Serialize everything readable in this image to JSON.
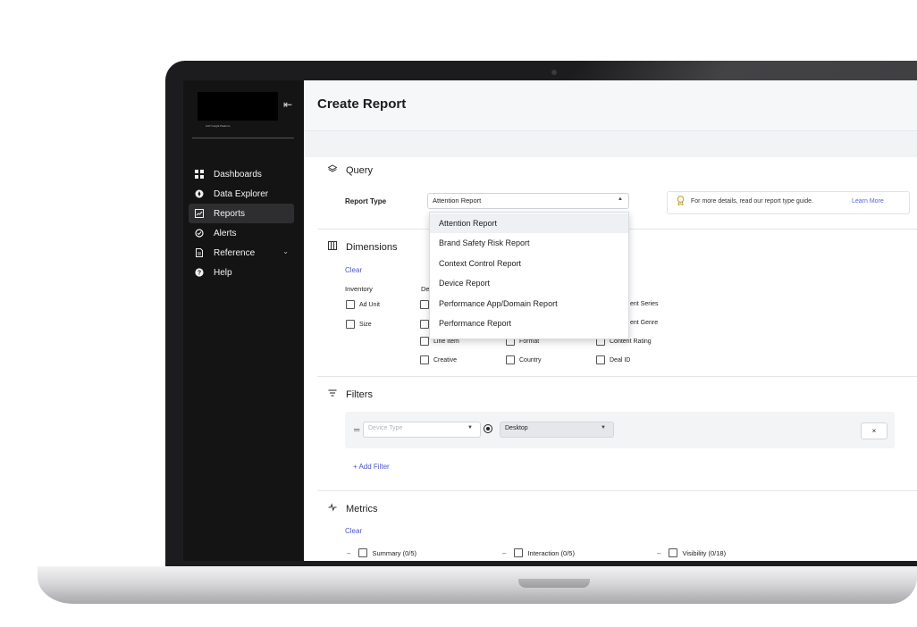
{
  "sidebar": {
    "logo_caption": "CAT Insight Platform",
    "items": [
      {
        "label": "Dashboards",
        "icon": "grid-icon"
      },
      {
        "label": "Data Explorer",
        "icon": "compass-icon"
      },
      {
        "label": "Reports",
        "icon": "report-icon"
      },
      {
        "label": "Alerts",
        "icon": "alert-icon"
      },
      {
        "label": "Reference",
        "icon": "document-icon"
      },
      {
        "label": "Help",
        "icon": "help-icon"
      }
    ]
  },
  "header": {
    "title": "Create Report"
  },
  "query": {
    "title": "Query",
    "report_type_label": "Report Type",
    "report_type_value": "Attention Report",
    "info_text": "For more details, read our report type guide.",
    "info_link": "Learn More",
    "options": [
      "Attention Report",
      "Brand Safety Risk Report",
      "Context Control Report",
      "Device Report",
      "Performance App/Domain Report",
      "Performance Report"
    ]
  },
  "dimensions": {
    "title": "Dimensions",
    "clear": "Clear",
    "col1_head": "Inventory",
    "col2_head": "De",
    "col1": [
      "Ad Unit",
      "Size"
    ],
    "col2": [
      "Line Item",
      "Creative"
    ],
    "col3": [
      "Format",
      "Country"
    ],
    "col4": [
      "ent Series",
      "ent Genre",
      "Content Rating",
      "Deal ID"
    ]
  },
  "filters": {
    "title": "Filters",
    "field_placeholder": "Device Type",
    "value": "Desktop",
    "remove": "×",
    "add": "+ Add Filter"
  },
  "metrics": {
    "title": "Metrics",
    "clear": "Clear",
    "groups": [
      "Summary (0/5)",
      "Interaction (0/5)",
      "Visibility (0/18)"
    ]
  }
}
